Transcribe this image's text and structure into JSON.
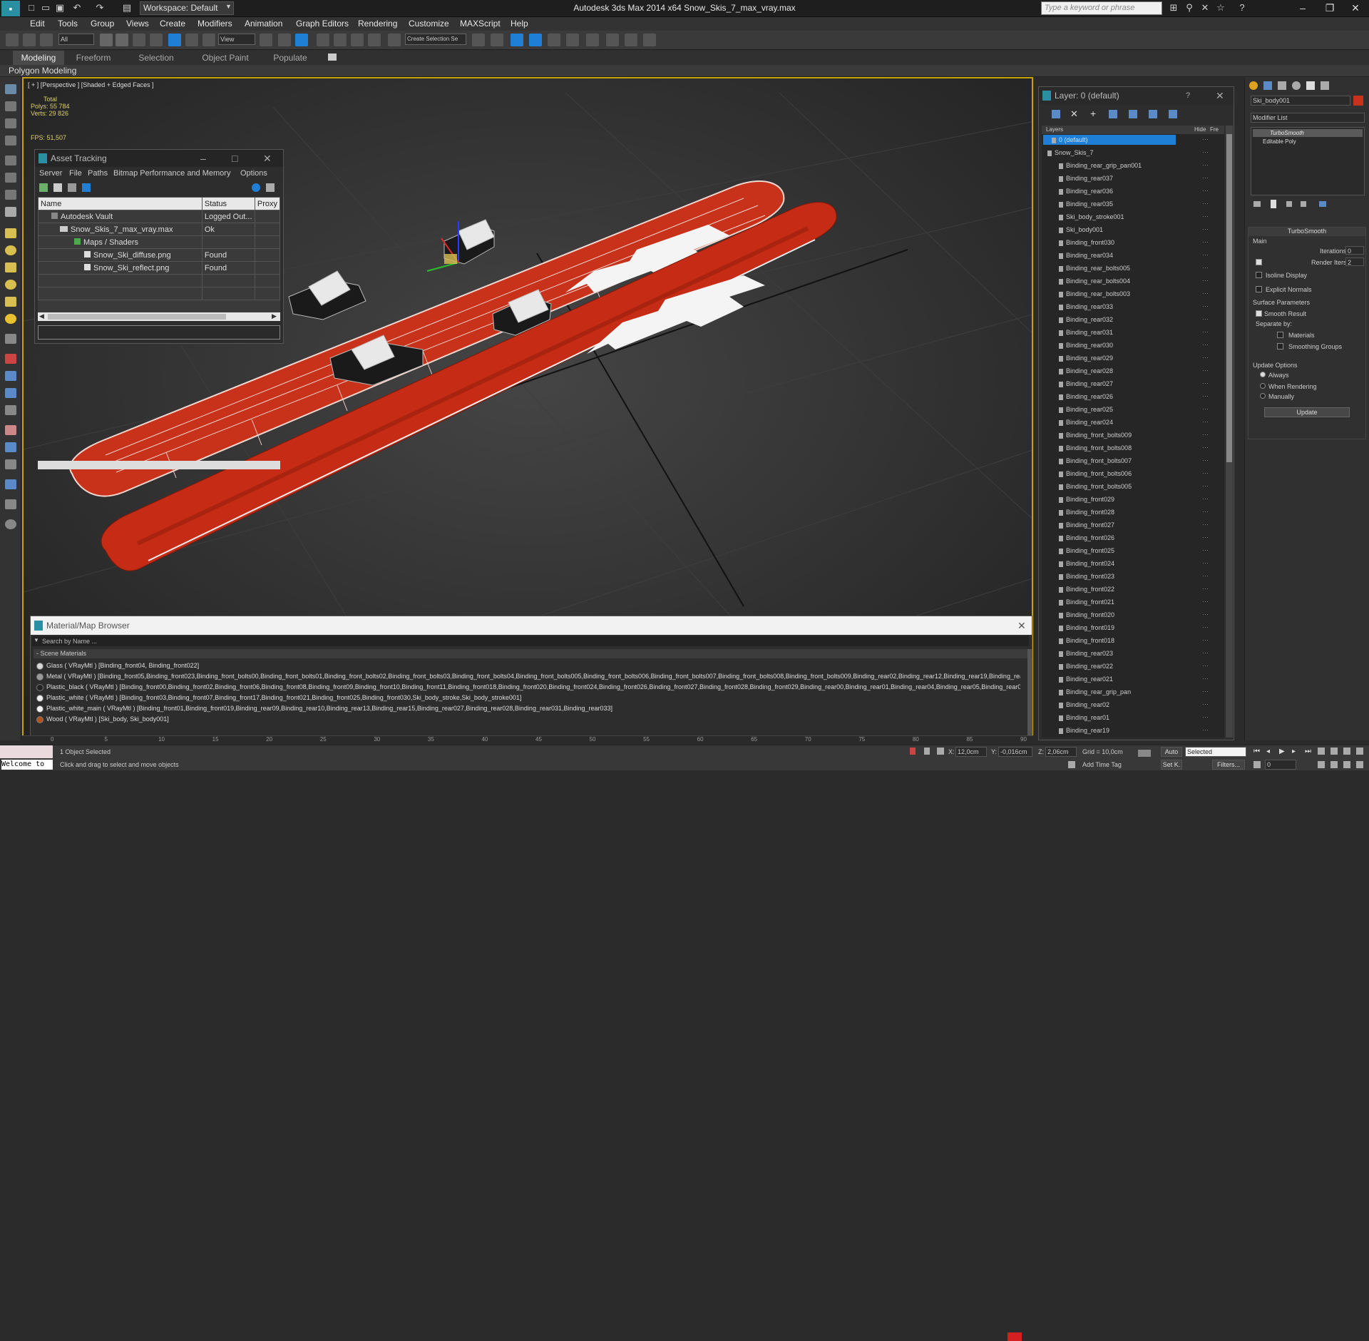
{
  "titlebar": {
    "workspace": "Workspace: Default",
    "title": "Autodesk 3ds Max  2014 x64     Snow_Skis_7_max_vray.max",
    "search_placeholder": "Type a keyword or phrase"
  },
  "menu": [
    "Edit",
    "Tools",
    "Group",
    "Views",
    "Create",
    "Modifiers",
    "Animation",
    "Graph Editors",
    "Rendering",
    "Customize",
    "MAXScript",
    "Help"
  ],
  "toolbar": {
    "selection_filter": "All",
    "ref_coord": "View",
    "named_selection": "Create Selection Se"
  },
  "ribbon": {
    "tabs": [
      "Modeling",
      "Freeform",
      "Selection",
      "Object Paint",
      "Populate"
    ],
    "sub": "Polygon Modeling"
  },
  "viewport": {
    "label": "[ + ] [Perspective ] [Shaded + Edged Faces ]",
    "stats_total": "Total",
    "polys": "Polys:  55 784",
    "verts": "Verts:  29 826",
    "fps": "FPS:     51,507"
  },
  "asset_tracking": {
    "title": "Asset Tracking",
    "menu": [
      "Server",
      "File",
      "Paths",
      "Bitmap Performance and Memory",
      "Options"
    ],
    "columns": [
      "Name",
      "Status",
      "Proxy"
    ],
    "rows": [
      {
        "name": "Autodesk Vault",
        "status": "Logged Out..."
      },
      {
        "name": "Snow_Skis_7_max_vray.max",
        "status": "Ok"
      },
      {
        "name": "Maps / Shaders",
        "status": ""
      },
      {
        "name": "Snow_Ski_diffuse.png",
        "status": "Found"
      },
      {
        "name": "Snow_Ski_reflect.png",
        "status": "Found"
      }
    ]
  },
  "layer_explorer": {
    "title": "Layer: 0 (default)",
    "col_layers": "Layers",
    "col_hide": "Hide",
    "col_freeze": "Fre",
    "items": [
      "0 (default)",
      "Snow_Skis_7",
      "Binding_rear_grip_pan001",
      "Binding_rear037",
      "Binding_rear036",
      "Binding_rear035",
      "Ski_body_stroke001",
      "Ski_body001",
      "Binding_front030",
      "Binding_rear034",
      "Binding_rear_bolts005",
      "Binding_rear_bolts004",
      "Binding_rear_bolts003",
      "Binding_rear033",
      "Binding_rear032",
      "Binding_rear031",
      "Binding_rear030",
      "Binding_rear029",
      "Binding_rear028",
      "Binding_rear027",
      "Binding_rear026",
      "Binding_rear025",
      "Binding_rear024",
      "Binding_front_bolts009",
      "Binding_front_bolts008",
      "Binding_front_bolts007",
      "Binding_front_bolts006",
      "Binding_front_bolts005",
      "Binding_front029",
      "Binding_front028",
      "Binding_front027",
      "Binding_front026",
      "Binding_front025",
      "Binding_front024",
      "Binding_front023",
      "Binding_front022",
      "Binding_front021",
      "Binding_front020",
      "Binding_front019",
      "Binding_front018",
      "Binding_rear023",
      "Binding_rear022",
      "Binding_rear021",
      "Binding_rear_grip_pan",
      "Binding_rear02",
      "Binding_rear01",
      "Binding_rear19"
    ]
  },
  "command_panel": {
    "object_name": "Ski_body001",
    "modifier_list": "Modifier List",
    "stack": [
      "TurboSmooth",
      "Editable Poly"
    ],
    "rollout_title": "TurboSmooth",
    "main": "Main",
    "iterations_label": "Iterations:",
    "iterations_value": "0",
    "render_iters_label": "Render Iters:",
    "render_iters_value": "2",
    "isoline": "Isoline Display",
    "explicit": "Explicit Normals",
    "surface_params": "Surface Parameters",
    "smooth_result": "Smooth Result",
    "separate_by": "Separate by:",
    "materials": "Materials",
    "smoothing_groups": "Smoothing Groups",
    "update_options": "Update Options",
    "always": "Always",
    "when_rendering": "When Rendering",
    "manually": "Manually",
    "update_button": "Update"
  },
  "material_browser": {
    "title": "Material/Map Browser",
    "search": "Search by Name ...",
    "section": "- Scene Materials",
    "rows": [
      {
        "text": "Glass ( VRayMtl ) [Binding_front04, Binding_front022]",
        "color": "#d8d8d8"
      },
      {
        "text": "Metal ( VRayMtl ) [Binding_front05,Binding_front023,Binding_front_bolts00,Binding_front_bolts01,Binding_front_bolts02,Binding_front_bolts03,Binding_front_bolts04,Binding_front_bolts005,Binding_front_bolts006,Binding_front_bolts007,Binding_front_bolts008,Binding_front_bolts009,Binding_rear02,Binding_rear12,Binding_rear19,Binding_rear20,...",
        "color": "#9a9a9a"
      },
      {
        "text": "Plastic_black ( VRayMtl ) [Binding_front00,Binding_front02,Binding_front06,Binding_front08,Binding_front09,Binding_front10,Binding_front11,Binding_front018,Binding_front020,Binding_front024,Binding_front026,Binding_front027,Binding_front028,Binding_front029,Binding_rear00,Binding_rear01,Binding_rear04,Binding_rear05,Binding_rear06,...",
        "color": "#222222"
      },
      {
        "text": "Plastic_white ( VRayMtl ) [Binding_front03,Binding_front07,Binding_front17,Binding_front021,Binding_front025,Binding_front030,Ski_body_stroke,Ski_body_stroke001]",
        "color": "#eeeeee"
      },
      {
        "text": "Plastic_white_main ( VRayMtl ) [Binding_front01,Binding_front019,Binding_rear09,Binding_rear10,Binding_rear13,Binding_rear15,Binding_rear027,Binding_rear028,Binding_rear031,Binding_rear033]",
        "color": "#f4f4f4"
      },
      {
        "text": "Wood ( VRayMtl ) [Ski_body, Ski_body001]",
        "color": "#b3541e"
      }
    ]
  },
  "timeline": {
    "ticks": [
      "0",
      "5",
      "10",
      "15",
      "20",
      "25",
      "30",
      "35",
      "40",
      "45",
      "50",
      "55",
      "60",
      "65",
      "70",
      "75",
      "80",
      "85",
      "90"
    ]
  },
  "status": {
    "maxscript": "Welcome to",
    "selected": "1 Object Selected",
    "prompt": "Click and drag to select and move objects",
    "x_label": "X:",
    "x": "12,0cm",
    "y_label": "Y:",
    "y": "-0,016cm",
    "z_label": "Z:",
    "z": "2,06cm",
    "grid": "Grid = 10,0cm",
    "auto": "Auto",
    "auto_sel": "Selected",
    "setk": "Set K.",
    "filters": "Filters...",
    "add_time_tag": "Add Time Tag",
    "frame": "0"
  },
  "colors": {
    "ski_red": "#c8321a",
    "selection": "#1f7fd6",
    "viewport_border": "#c8a200"
  }
}
